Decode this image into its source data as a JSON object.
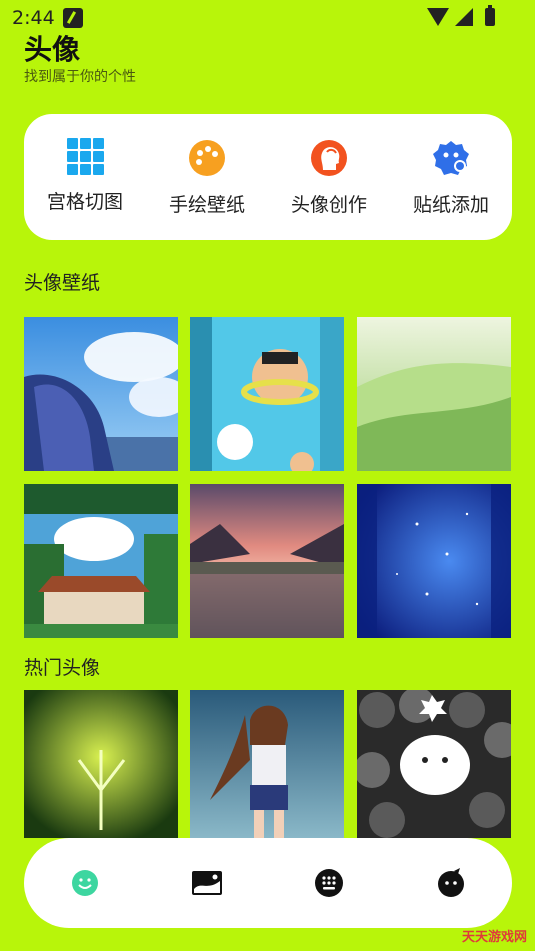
{
  "status": {
    "time": "2:44"
  },
  "header": {
    "title": "头像",
    "subtitle": "找到属于你的个性"
  },
  "tools": [
    {
      "label": "宫格切图",
      "icon": "grid-icon",
      "color": "#1aa8ee"
    },
    {
      "label": "手绘壁纸",
      "icon": "palette-icon",
      "color": "#f7a020"
    },
    {
      "label": "头像创作",
      "icon": "profile-head-icon",
      "color": "#f2521f"
    },
    {
      "label": "贴纸添加",
      "icon": "sticker-face-icon",
      "color": "#2f6fe8"
    }
  ],
  "sections": {
    "wallpapers": {
      "title": "头像壁纸"
    },
    "hot": {
      "title": "热门头像"
    }
  },
  "nav": [
    {
      "icon": "smiley-icon",
      "color": "#3dd6a0"
    },
    {
      "icon": "image-icon",
      "color": "#111111"
    },
    {
      "icon": "keypad-icon",
      "color": "#111111"
    },
    {
      "icon": "face-icon",
      "color": "#111111"
    }
  ],
  "watermark": {
    "text": "天天游戏网"
  }
}
